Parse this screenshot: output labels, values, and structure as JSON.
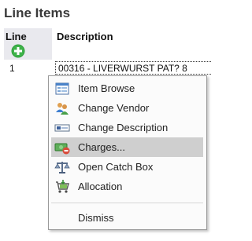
{
  "section": {
    "title": "Line Items"
  },
  "table": {
    "columns": [
      "Line",
      "Description"
    ],
    "rows": [
      {
        "line": "1",
        "description": "00316 - LIVERWURST PAT? 8"
      }
    ]
  },
  "context_menu": {
    "items": [
      {
        "label": "Item Browse",
        "icon": "item-browse-icon"
      },
      {
        "label": "Change Vendor",
        "icon": "change-vendor-icon"
      },
      {
        "label": "Change Description",
        "icon": "change-description-icon"
      },
      {
        "label": "Charges...",
        "icon": "charges-icon",
        "selected": true
      },
      {
        "label": "Open Catch Box",
        "icon": "scale-icon"
      },
      {
        "label": "Allocation",
        "icon": "allocation-icon"
      }
    ],
    "dismiss_label": "Dismiss"
  },
  "colors": {
    "header_bg": "#e9e9ee",
    "selected_bg": "#cfcfcf",
    "add_icon": "#2e9e3a"
  }
}
